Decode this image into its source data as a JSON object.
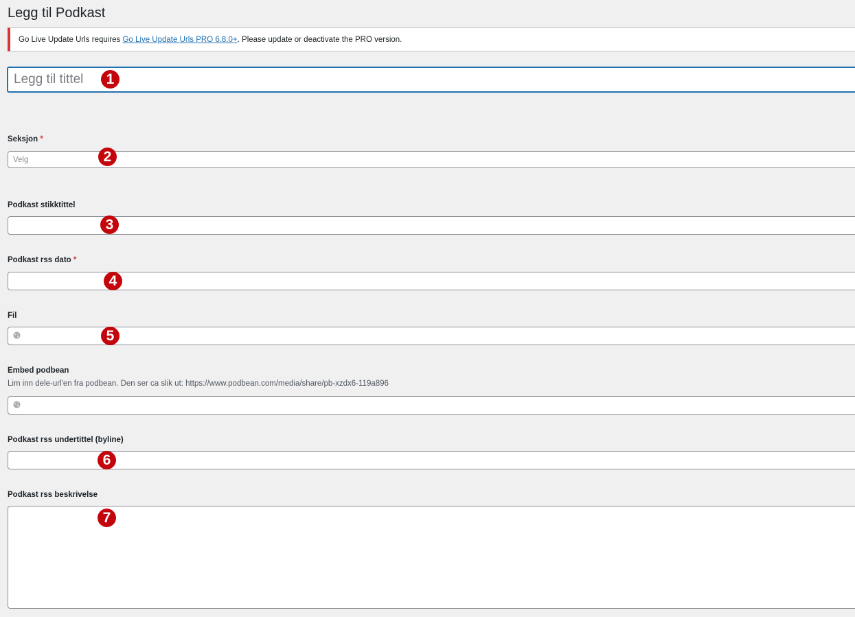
{
  "page": {
    "title": "Legg til Podkast"
  },
  "notice": {
    "text_before": "Go Live Update Urls requires ",
    "link_text": "Go Live Update Urls PRO 6.8.0+",
    "text_after": ". Please update or deactivate the PRO version."
  },
  "title_field": {
    "placeholder": "Legg til tittel"
  },
  "fields": {
    "seksjon": {
      "label": "Seksjon",
      "required_mark": "*",
      "placeholder": "Velg"
    },
    "stikktittel": {
      "label": "Podkast stikktittel"
    },
    "rss_dato": {
      "label": "Podkast rss dato",
      "required_mark": "*"
    },
    "fil": {
      "label": "Fil",
      "icon": "globe-icon"
    },
    "embed": {
      "label": "Embed podbean",
      "description": "Lim inn dele-url'en fra podbean. Den ser ca slik ut: https://www.podbean.com/media/share/pb-xzdx6-119a896",
      "icon": "globe-icon"
    },
    "undertittel": {
      "label": "Podkast rss undertittel (byline)"
    },
    "beskrivelse": {
      "label": "Podkast rss beskrivelse"
    }
  },
  "markers": [
    "1",
    "2",
    "3",
    "4",
    "5",
    "6",
    "7"
  ],
  "colors": {
    "background": "#f0f0f1",
    "accent": "#2271b1",
    "error": "#d63638",
    "marker": "#c4050b"
  }
}
